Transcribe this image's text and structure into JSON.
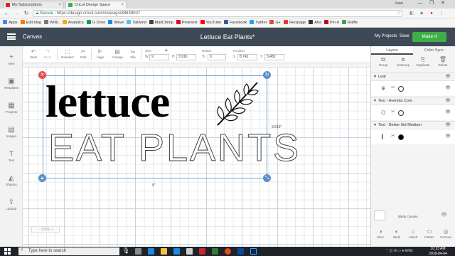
{
  "browser": {
    "tabs": [
      {
        "label": "My Subscriptions",
        "favicon_color": "#e62117"
      },
      {
        "label": "Cricut Design Space",
        "favicon_color": "#3fae49",
        "active": true
      }
    ],
    "user_label": "Joan",
    "window_controls": [
      "—",
      "❐",
      "✕"
    ],
    "address": {
      "secure_label": "Secure",
      "url": "https://design.cricut.com/#/design/88839007"
    },
    "bookmarks": [
      {
        "label": "Apps",
        "color": "#4285f4"
      },
      {
        "label": "Edit blog",
        "color": "#f57c00"
      },
      {
        "label": "WIRL",
        "color": "#777777"
      },
      {
        "label": "Analytics",
        "color": "#f9ab00"
      },
      {
        "label": "G Drive",
        "color": "#0f9d58"
      },
      {
        "label": "Wave",
        "color": "#1e88e5"
      },
      {
        "label": "Tailwind",
        "color": "#4fc3f7"
      },
      {
        "label": "MailChimp",
        "color": "#444444"
      },
      {
        "label": "Pinterest",
        "color": "#e60023"
      },
      {
        "label": "YouTube",
        "color": "#ff0000"
      },
      {
        "label": "Facebook",
        "color": "#3b5998"
      },
      {
        "label": "Twitter",
        "color": "#1da1f2"
      },
      {
        "label": "G+",
        "color": "#dd4b39"
      },
      {
        "label": "Recipage",
        "color": "#e53935"
      },
      {
        "label": "Aha",
        "color": "#333333"
      },
      {
        "label": "Pin-It",
        "color": "#bd081c"
      },
      {
        "label": "Raffle",
        "color": "#43a047"
      }
    ]
  },
  "header": {
    "menu_label": "Canvas",
    "project_title": "Lettuce Eat Plants*",
    "my_projects": "My Projects",
    "save": "Save",
    "make_it": "Make It"
  },
  "toolbar": {
    "undo": "Undo",
    "redo": "Redo",
    "deselect": "Deselect",
    "edit": "Edit",
    "align": "Align",
    "arrange": "Arrange",
    "flip": "Flip",
    "size_label": "Size",
    "w_label": "W",
    "w_value": "9",
    "h_label": "H",
    "h_value": "3.916",
    "rotate_label": "Rotate",
    "rotate_value": "0",
    "position_label": "Position",
    "x_label": "X",
    "x_value": "8.741",
    "y_label": "Y",
    "y_value": "3.482"
  },
  "left_tools": [
    {
      "label": "New",
      "icon": "plus-icon",
      "glyph": "+"
    },
    {
      "label": "Templates",
      "icon": "shirt-icon",
      "glyph": "▣"
    },
    {
      "label": "Projects",
      "icon": "grid-icon",
      "glyph": "▦"
    },
    {
      "label": "Images",
      "icon": "image-icon",
      "glyph": "▤"
    },
    {
      "label": "Text",
      "icon": "text-icon",
      "glyph": "T"
    },
    {
      "label": "Shapes",
      "icon": "shapes-icon",
      "glyph": "◭"
    },
    {
      "label": "Upload",
      "icon": "upload-icon",
      "glyph": "⇪"
    }
  ],
  "canvas": {
    "line1": "lettuce",
    "line2": "EAT PLANTS",
    "height_dim": "3.916\"",
    "width_dim": "9\"",
    "zoom": "100%"
  },
  "layers_panel": {
    "tab_layers": "Layers",
    "tab_color_sync": "Color Sync",
    "actions": [
      {
        "label": "Group",
        "icon": "group-icon",
        "glyph": "⧉"
      },
      {
        "label": "UnGroup",
        "icon": "ungroup-icon",
        "glyph": "⧈"
      },
      {
        "label": "Duplicate",
        "icon": "duplicate-icon",
        "glyph": "⎘"
      },
      {
        "label": "Delete",
        "icon": "trash-icon",
        "glyph": "🗑"
      }
    ],
    "groups": [
      {
        "name": "Leaf",
        "fill": "#ffffff"
      },
      {
        "name": "Text - Avenida Com",
        "fill": "#ffffff"
      },
      {
        "name": "Text - Belwe Std Medium",
        "fill": "#000000"
      }
    ],
    "blank_canvas": "Blank Canvas",
    "bottom_actions": [
      {
        "label": "Slice",
        "icon": "slice-icon",
        "glyph": "◑"
      },
      {
        "label": "Weld",
        "icon": "weld-icon",
        "glyph": "◐"
      },
      {
        "label": "Attach",
        "icon": "attach-icon",
        "glyph": "⌂"
      },
      {
        "label": "Flatten",
        "icon": "flatten-icon",
        "glyph": "▭"
      },
      {
        "label": "Contour",
        "icon": "contour-icon",
        "glyph": "◎"
      }
    ]
  },
  "taskbar": {
    "search_placeholder": "Type here to search",
    "tray_lang": "ENG",
    "time": "10:23 AM",
    "date": "2018-04-04"
  }
}
